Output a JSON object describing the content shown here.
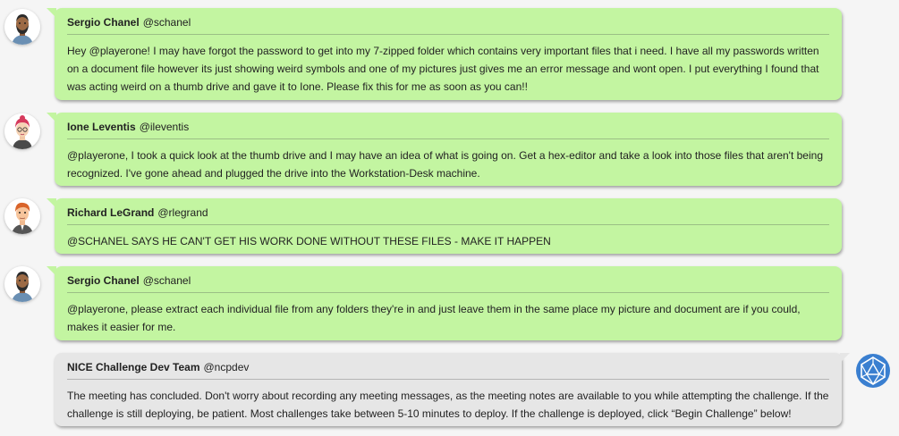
{
  "messages": [
    {
      "name": "Sergio Chanel",
      "handle": "@schanel",
      "avatar_icon": "man-beard-avatar-icon",
      "text": "Hey @playerone! I may have forgot the password to get into my 7-zipped folder which contains very important files that i need. I have all my passwords written on a document file however its just showing weird symbols and one of my pictures just gives me an error message and wont open. I put everything I found that was acting weird on a thumb drive and gave it to Ione. Please fix this for me as soon as you can!!"
    },
    {
      "name": "Ione Leventis",
      "handle": "@ileventis",
      "avatar_icon": "woman-glasses-avatar-icon",
      "text": "@playerone, I took a quick look at the thumb drive and I may have an idea of what is going on. Get a hex-editor and take a look into those files that aren't being recognized. I've gone ahead and plugged the drive into the Workstation-Desk machine."
    },
    {
      "name": "Richard LeGrand",
      "handle": "@rlegrand",
      "avatar_icon": "man-redhair-avatar-icon",
      "text": "@SCHANEL SAYS HE CAN'T GET HIS WORK DONE WITHOUT THESE FILES - MAKE IT HAPPEN"
    },
    {
      "name": "Sergio Chanel",
      "handle": "@schanel",
      "avatar_icon": "man-beard-avatar-icon",
      "text": "@playerone, please extract each individual file from any folders they're in and just leave them in the same place my picture and document are if you could, makes it easier for me."
    },
    {
      "name": "NICE Challenge Dev Team",
      "handle": "@ncpdev",
      "avatar_icon": "nice-logo-icon",
      "text": "The meeting has concluded. Don't worry about recording any meeting messages, as the meeting notes are available to you while attempting the challenge. If the challenge is still deploying, be patient. Most challenges take between 5-10 minutes to deploy. If the challenge is deployed, click “Begin Challenge” below!"
    }
  ],
  "colors": {
    "user_bubble": "#c3f5a1",
    "system_bubble": "#e6e6e6",
    "logo_blue": "#3a7fd0"
  }
}
